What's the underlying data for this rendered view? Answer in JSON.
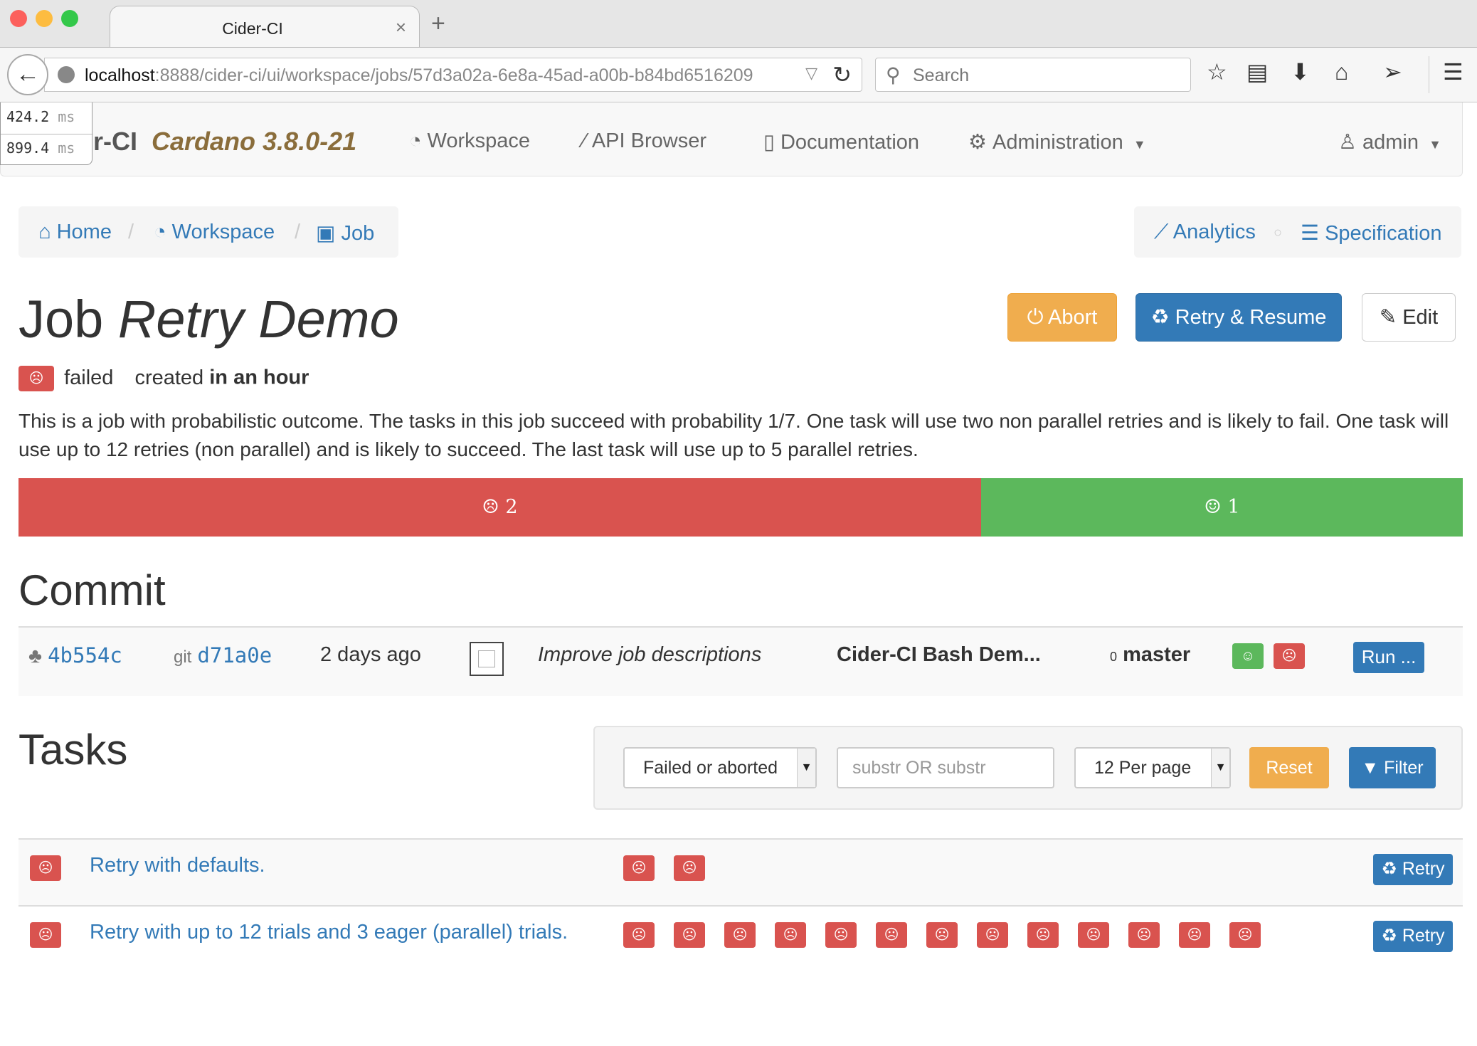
{
  "browser": {
    "tab_title": "Cider-CI",
    "tab_close": "×",
    "new_tab": "+",
    "url_host": "localhost",
    "url_path": ":8888/cider-ci/ui/workspace/jobs/57d3a02a-6e8a-45ad-a00b-b84bd6516209",
    "search_placeholder": "Search"
  },
  "perf": {
    "first_value": "424.2",
    "second_value": "899.4",
    "unit": "ms"
  },
  "navbar": {
    "brand": "r-CI",
    "version": "Cardano 3.8.0-21",
    "items": [
      {
        "label": "Workspace",
        "icon": "dashboard-icon"
      },
      {
        "label": "API Browser",
        "icon": "magic-wand-icon"
      },
      {
        "label": "Documentation",
        "icon": "file-icon"
      },
      {
        "label": "Administration",
        "icon": "gear-icon"
      }
    ],
    "user": "admin"
  },
  "breadcrumb": {
    "home": "Home",
    "workspace": "Workspace",
    "job": "Job",
    "separator": "/",
    "analytics": "Analytics",
    "specification": "Specification",
    "dot": "○"
  },
  "job": {
    "title_prefix": "Job",
    "title_name": "Retry Demo",
    "status": "failed",
    "created_label": "created",
    "created_value": "in an hour",
    "description": "This is a job with probabilistic outcome. The tasks in this job succeed with probability 1/7. One task will use two non parallel retries and is likely to fail. One task will use up to 12 retries (non parallel) and is likely to succeed. The last task will use up to 5 parallel retries.",
    "buttons": {
      "abort": "Abort",
      "retry_resume": "Retry & Resume",
      "edit": "Edit"
    }
  },
  "progress": {
    "failed_count": "2",
    "passed_count": "1",
    "failed_fraction": 0.6667,
    "passed_fraction": 0.3333,
    "colors": {
      "failed": "#d9534f",
      "passed": "#5cb85c"
    }
  },
  "commit": {
    "heading": "Commit",
    "tree_id": "4b554c",
    "git_label": "git",
    "commit_id": "d71a0e",
    "age": "2 days ago",
    "message": "Improve job descriptions",
    "repository": "Cider-CI Bash Dem...",
    "branch_count": "0",
    "branch": "master",
    "run_label": "Run ..."
  },
  "tasks": {
    "heading": "Tasks",
    "filter": {
      "state_value": "Failed or aborted",
      "search_placeholder": "substr OR substr",
      "per_page_value": "12 Per page",
      "reset_label": "Reset",
      "filter_label": "Filter"
    },
    "rows": [
      {
        "name": "Retry with defaults.",
        "trials": 2,
        "retry_label": "Retry"
      },
      {
        "name": "Retry with up to 12 trials and 3 eager (parallel) trials.",
        "trials": 13,
        "retry_label": "Retry"
      }
    ]
  }
}
